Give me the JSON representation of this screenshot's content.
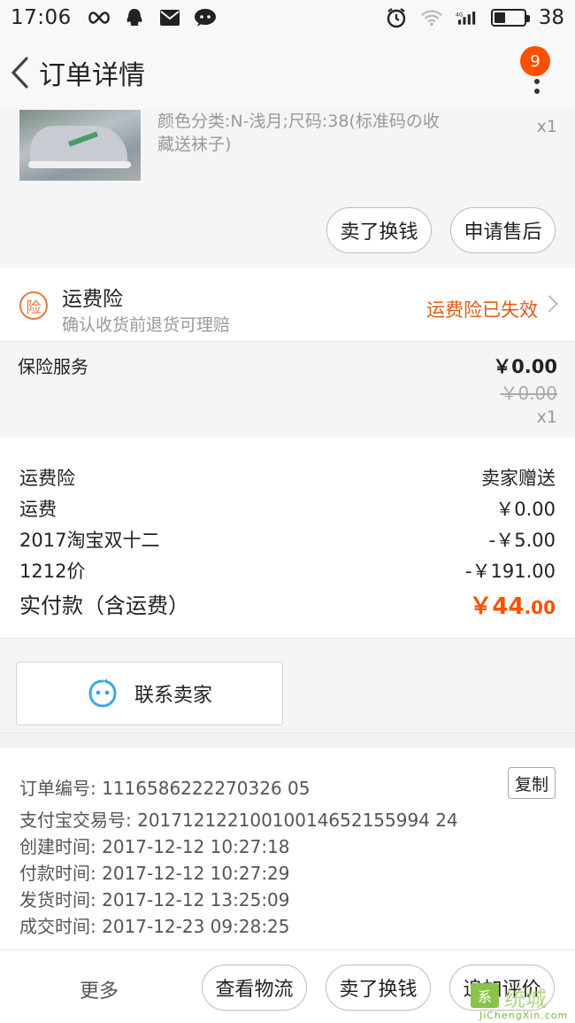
{
  "status_bar": {
    "time": "17:06",
    "battery_level": "38",
    "battery_fraction": 0.38,
    "icons": [
      "infinity-icon",
      "qq-icon",
      "mail-icon",
      "wechat-icon",
      "alarm-icon",
      "wifi-icon",
      "signal-4g-icon",
      "battery-icon"
    ]
  },
  "nav": {
    "title": "订单详情",
    "badge_count": "9"
  },
  "product": {
    "spec": "颜色分类:N-浅月;尺码:38(标准码の收藏送袜子)",
    "qty": "x1",
    "btn_sell_exchange": "卖了换钱",
    "btn_after_sale": "申请售后"
  },
  "shipping_insurance": {
    "icon_char": "险",
    "title": "运费险",
    "subtitle": "确认收货前退货可理赔",
    "status": "运费险已失效"
  },
  "insurance_service": {
    "name": "保险服务",
    "price": "￥0.00",
    "original_price": "￥0.00",
    "qty": "x1"
  },
  "costs": {
    "rows": [
      {
        "label": "运费险",
        "value": "卖家赠送"
      },
      {
        "label": "运费",
        "value": "￥0.00"
      },
      {
        "label": "2017淘宝双十二",
        "value": "-￥5.00"
      },
      {
        "label": "1212价",
        "value": "-￥191.00"
      }
    ],
    "total_label": "实付款（含运费）",
    "total_main": "￥44",
    "total_decimal": ".00"
  },
  "contact": {
    "label": "联系卖家"
  },
  "order_info": {
    "order_no": "订单编号: 1116586222270326 05",
    "copy_label": "复制",
    "alipay_no": "支付宝交易号: 20171212210010014652155994 24",
    "created": "创建时间: 2017-12-12 10:27:18",
    "paid": "付款时间: 2017-12-12 10:27:29",
    "shipped": "发货时间: 2017-12-12 13:25:09",
    "completed": "成交时间: 2017-12-23 09:28:25"
  },
  "bottom_bar": {
    "more": "更多",
    "logistics": "查看物流",
    "sell_exchange": "卖了换钱",
    "add_review": "追加评价"
  },
  "watermark": {
    "box_char": "系",
    "text": "统城",
    "url": "JiChengXin.com"
  },
  "colors": {
    "accent_orange": "#ff5000",
    "status_orange": "#e05a16",
    "insurance_icon": "#e8783c",
    "contact_icon": "#3aa8e0"
  }
}
